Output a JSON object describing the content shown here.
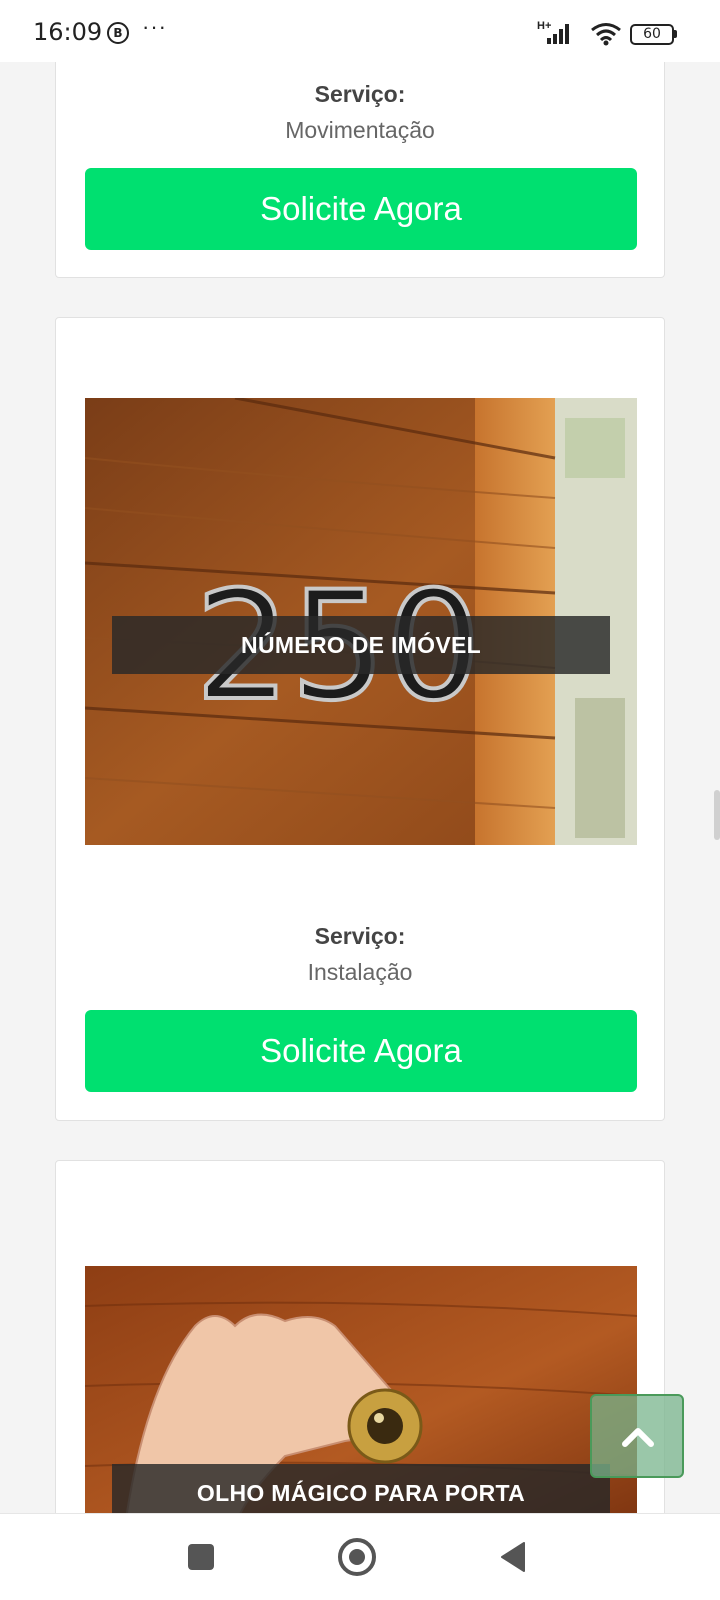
{
  "status_bar": {
    "time": "16:09",
    "notification_icon": "B",
    "overflow": "···",
    "network_type": "H+",
    "battery": "60"
  },
  "cards": [
    {
      "service_label": "Serviço:",
      "service_value": "Movimentação",
      "button_label": "Solicite Agora"
    },
    {
      "image_caption": "NÚMERO DE IMÓVEL",
      "service_label": "Serviço:",
      "service_value": "Instalação",
      "button_label": "Solicite Agora"
    },
    {
      "image_caption": "OLHO MÁGICO PARA PORTA"
    }
  ],
  "colors": {
    "cta_green": "#00e070",
    "scroll_button": "#78b48c"
  },
  "icons": {
    "scroll_top": "chevron-up-icon",
    "nav_recents": "square-icon",
    "nav_home": "circle-icon",
    "nav_back": "triangle-back-icon"
  }
}
